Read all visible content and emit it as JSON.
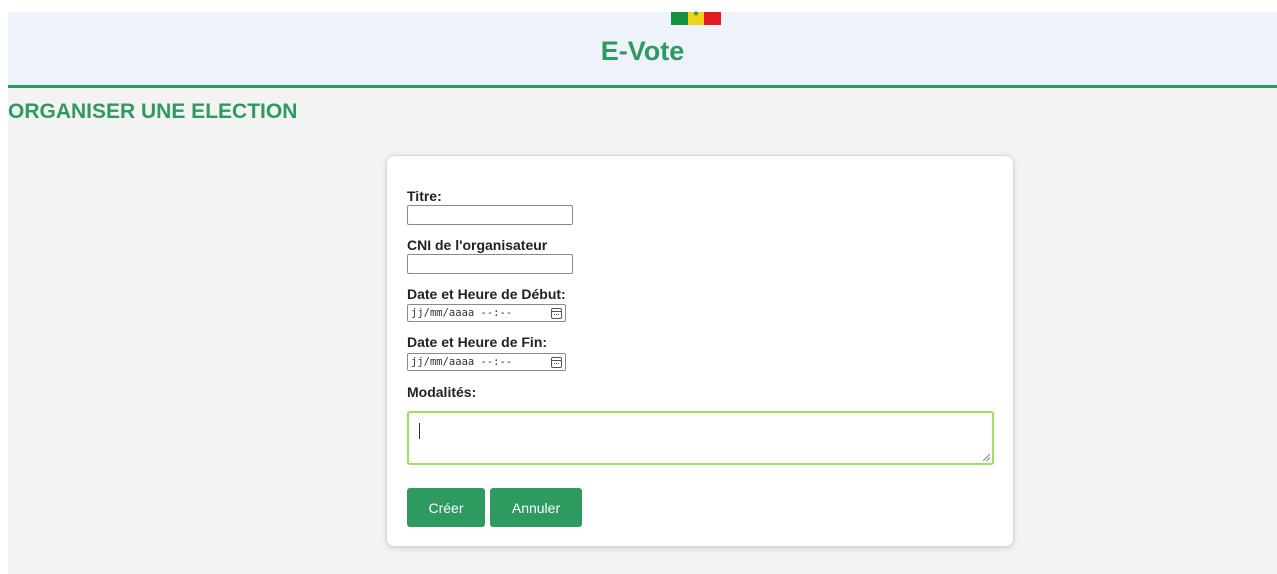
{
  "header": {
    "app_title": "E-Vote",
    "flag_icon": "senegal-flag-icon",
    "colors": {
      "brand": "#2e9a5f",
      "header_bg": "#eef3fb"
    }
  },
  "page": {
    "heading": "ORGANISER UNE ELECTION"
  },
  "form": {
    "titre_label": "Titre:",
    "titre_value": "",
    "cni_label": "CNI de l'organisateur",
    "cni_value": "",
    "debut_label": "Date et Heure de Début:",
    "debut_value": "jj/mm/aaaa --:--",
    "fin_label": "Date et Heure de Fin:",
    "fin_value": "jj/mm/aaaa --:--",
    "modalites_label": "Modalités:",
    "modalites_value": "",
    "create_button": "Créer",
    "cancel_button": "Annuler"
  }
}
